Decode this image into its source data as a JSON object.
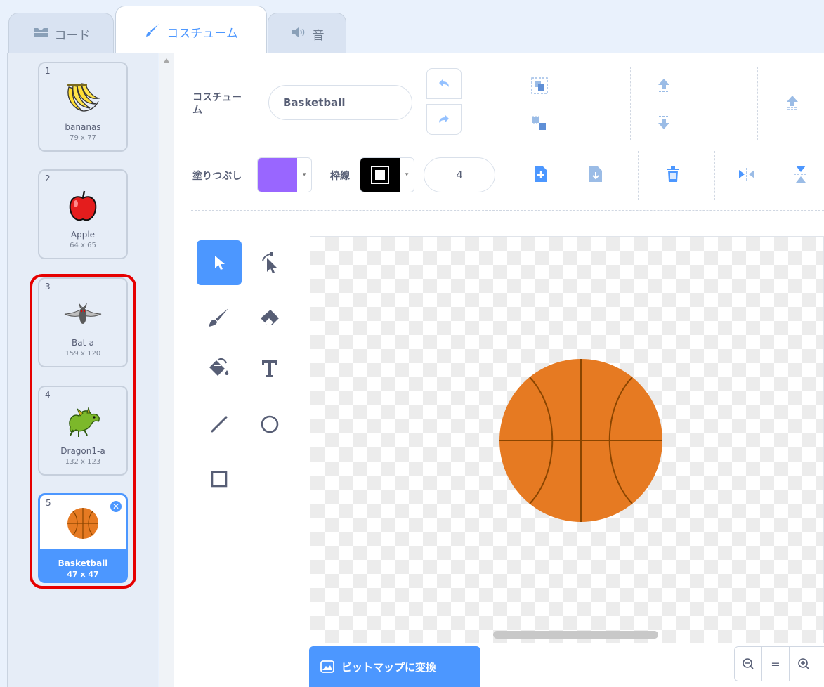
{
  "tabs": {
    "code": "コード",
    "costume": "コスチューム",
    "sound": "音"
  },
  "costumes": [
    {
      "num": "1",
      "name": "bananas",
      "size": "79 x 77"
    },
    {
      "num": "2",
      "name": "Apple",
      "size": "64 x 65"
    },
    {
      "num": "3",
      "name": "Bat-a",
      "size": "159 x 120"
    },
    {
      "num": "4",
      "name": "Dragon1-a",
      "size": "132 x 123"
    },
    {
      "num": "5",
      "name": "Basketball",
      "size": "47 x 47",
      "selected": true
    }
  ],
  "editor": {
    "costume_label": "コスチュー\nム",
    "costume_name": "Basketball",
    "fill_label": "塗りつぶし",
    "outline_label": "枠線",
    "outline_width": "4",
    "fill_color": "#9966ff",
    "outline_color": "#000000",
    "convert_button": "ビットマップに変換",
    "zoom_reset": "="
  },
  "colors": {
    "accent": "#4c97ff",
    "highlight": "#e60000",
    "ball": "#e67a22",
    "ball_lines": "#8a4500"
  },
  "icons": {
    "code_tab": "code-icon",
    "costume_tab": "brush-icon",
    "sound_tab": "speaker-icon",
    "undo": "undo-icon",
    "redo": "redo-icon",
    "group": "group-icon",
    "ungroup": "ungroup-icon",
    "forward": "forward-icon",
    "backward": "backward-icon",
    "front": "front-icon",
    "copy": "copy-icon",
    "paste": "paste-icon",
    "delete": "trash-icon",
    "flip_h": "flip-horizontal-icon",
    "flip_v": "flip-vertical-icon",
    "select": "select-arrow-icon",
    "reshape": "reshape-icon",
    "brush": "brush-icon",
    "eraser": "eraser-icon",
    "fill": "fill-bucket-icon",
    "text": "text-icon",
    "line": "line-icon",
    "circle": "circle-icon",
    "rect": "rectangle-icon",
    "zoom_out": "zoom-out-icon",
    "zoom_in": "zoom-in-icon",
    "bitmap": "image-icon"
  }
}
